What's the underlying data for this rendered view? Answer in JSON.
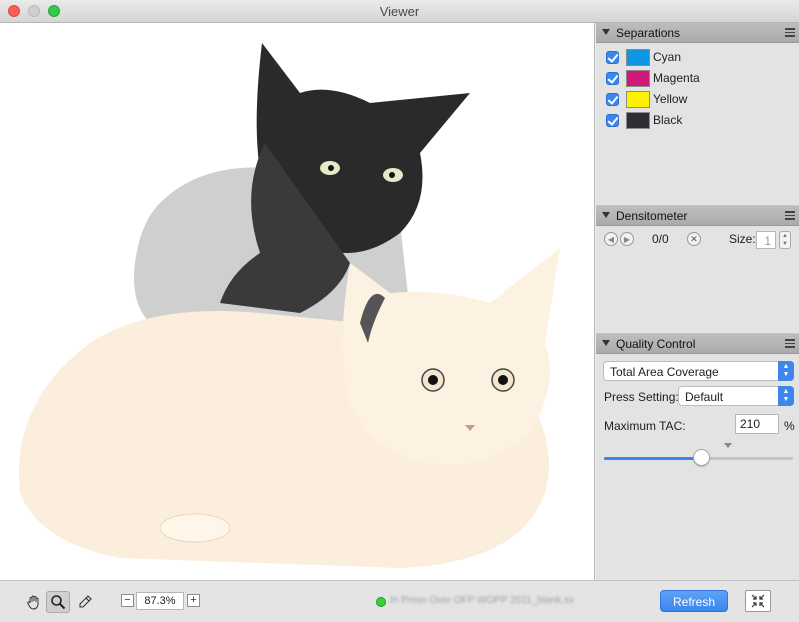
{
  "window": {
    "title": "Viewer"
  },
  "separations": {
    "title": "Separations",
    "items": [
      {
        "label": "Cyan",
        "color": "#0e97e2",
        "checked": true
      },
      {
        "label": "Magenta",
        "color": "#d01878",
        "checked": true
      },
      {
        "label": "Yellow",
        "color": "#fdf200",
        "checked": true
      },
      {
        "label": "Black",
        "color": "#2e2e33",
        "checked": true
      }
    ]
  },
  "densitometer": {
    "title": "Densitometer",
    "counter": "0/0",
    "size_label": "Size:",
    "size_value": "1"
  },
  "quality_control": {
    "title": "Quality Control",
    "mode": "Total Area Coverage",
    "press_label": "Press Setting:",
    "press_value": "Default",
    "tac_label": "Maximum TAC:",
    "tac_value": "210",
    "tac_unit": "%",
    "slider_fraction": 0.52
  },
  "toolbar": {
    "zoom_value": "87.3%",
    "zoom_minus": "−",
    "zoom_plus": "+",
    "status_text": "In Press Over OFP WOPP 2011_blank.xx",
    "refresh_label": "Refresh"
  },
  "icons": {
    "hand": "hand-tool-icon",
    "zoom": "magnifier-icon",
    "picker": "eyedropper-icon"
  }
}
